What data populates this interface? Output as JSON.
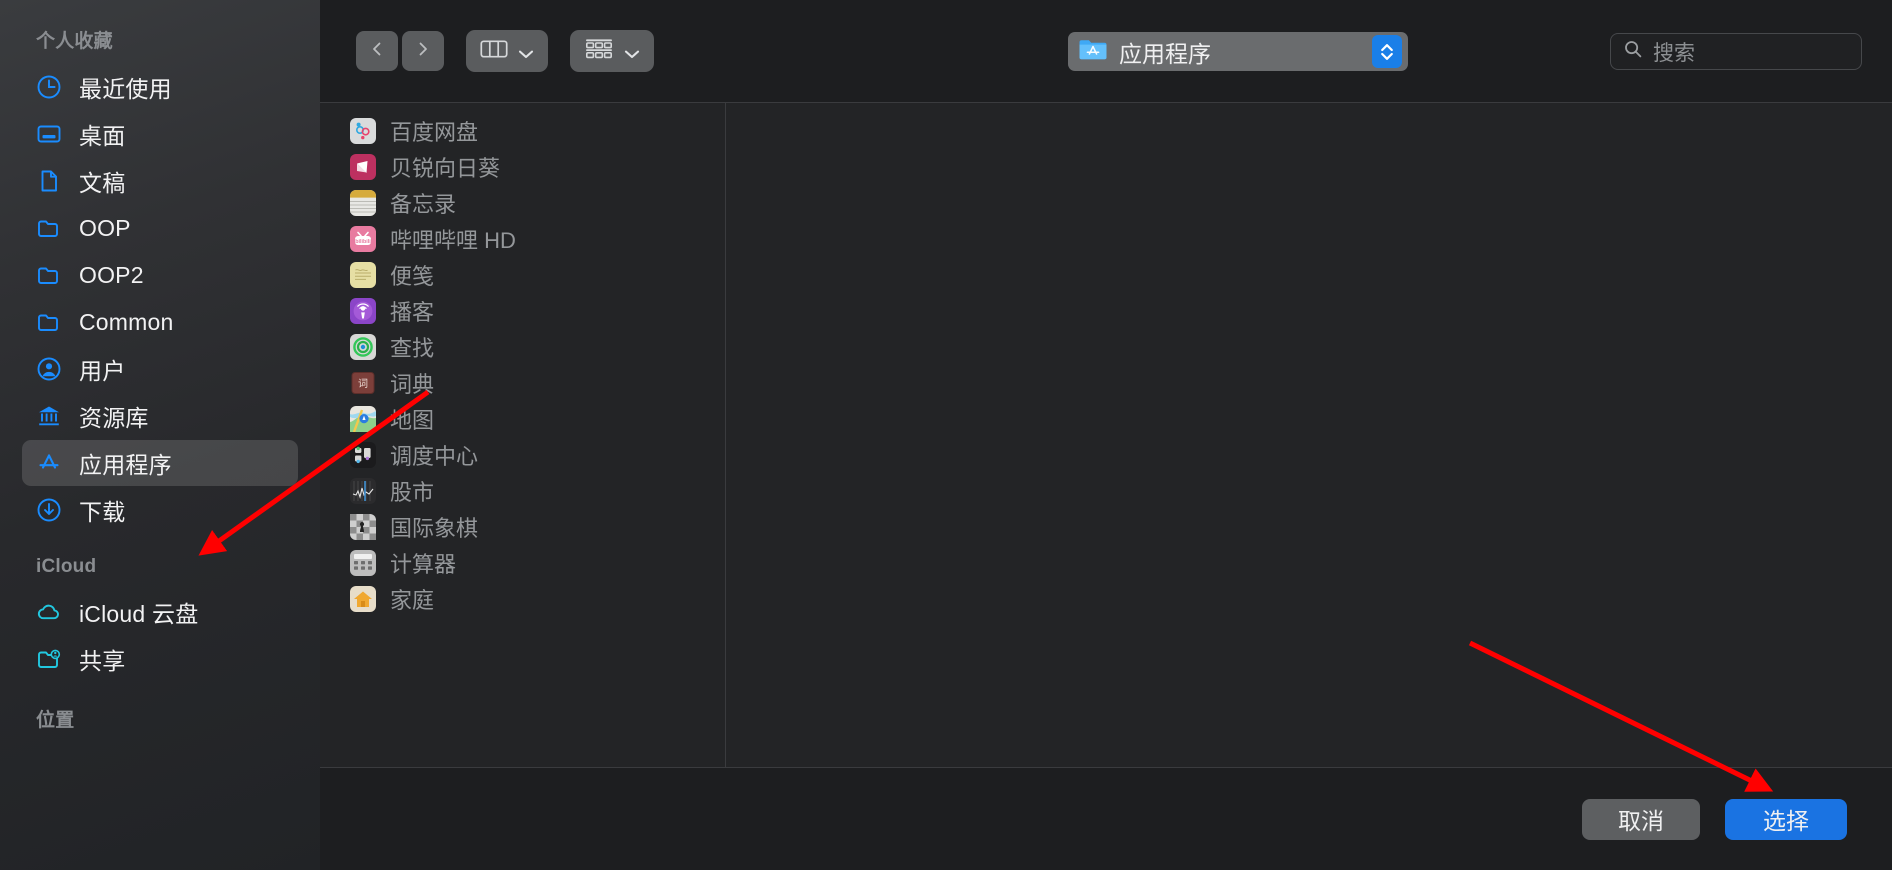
{
  "sidebar": {
    "sections": [
      {
        "title": "个人收藏",
        "items": [
          {
            "label": "最近使用",
            "icon": "clock-icon",
            "selected": false
          },
          {
            "label": "桌面",
            "icon": "desktop-icon",
            "selected": false
          },
          {
            "label": "文稿",
            "icon": "document-icon",
            "selected": false
          },
          {
            "label": "OOP",
            "icon": "folder-icon",
            "selected": false
          },
          {
            "label": "OOP2",
            "icon": "folder-icon",
            "selected": false
          },
          {
            "label": "Common",
            "icon": "folder-icon",
            "selected": false
          },
          {
            "label": "用户",
            "icon": "user-icon",
            "selected": false
          },
          {
            "label": "资源库",
            "icon": "library-icon",
            "selected": false
          },
          {
            "label": "应用程序",
            "icon": "appstore-icon",
            "selected": true
          },
          {
            "label": "下载",
            "icon": "download-icon",
            "selected": false
          }
        ]
      },
      {
        "title": "iCloud",
        "items": [
          {
            "label": "iCloud 云盘",
            "icon": "cloud-icon",
            "selected": false
          },
          {
            "label": "共享",
            "icon": "shared-folder-icon",
            "selected": false
          }
        ]
      },
      {
        "title": "位置",
        "items": []
      }
    ]
  },
  "toolbar": {
    "back_icon": "chevron-left-icon",
    "forward_icon": "chevron-right-icon",
    "view_icon": "column-view-icon",
    "view_chevron_icon": "chevron-down-icon",
    "group_icon": "group-by-icon",
    "group_chevron_icon": "chevron-down-icon",
    "path": {
      "label": "应用程序",
      "folder_icon": "appstore-folder-icon",
      "stepper_icon": "up-down-stepper-icon"
    },
    "search": {
      "placeholder": "搜索",
      "icon": "search-icon",
      "value": ""
    }
  },
  "file_list": {
    "items": [
      {
        "name": "百度网盘",
        "icon": "baidu-netdisk-icon"
      },
      {
        "name": "贝锐向日葵",
        "icon": "sunlogin-icon"
      },
      {
        "name": "备忘录",
        "icon": "notes-icon"
      },
      {
        "name": "哔哩哔哩 HD",
        "icon": "bilibili-icon"
      },
      {
        "name": "便笺",
        "icon": "stickies-icon"
      },
      {
        "name": "播客",
        "icon": "podcasts-icon"
      },
      {
        "name": "查找",
        "icon": "findmy-icon"
      },
      {
        "name": "词典",
        "icon": "dictionary-icon"
      },
      {
        "name": "地图",
        "icon": "maps-icon"
      },
      {
        "name": "调度中心",
        "icon": "mission-control-icon"
      },
      {
        "name": "股市",
        "icon": "stocks-icon"
      },
      {
        "name": "国际象棋",
        "icon": "chess-icon"
      },
      {
        "name": "计算器",
        "icon": "calculator-icon"
      },
      {
        "name": "家庭",
        "icon": "home-icon"
      }
    ]
  },
  "footer": {
    "cancel_label": "取消",
    "choose_label": "选择"
  },
  "colors": {
    "accent": "#1a73e2",
    "sidebar_icon": "#1a8cff",
    "icloud_icon": "#22c8e0",
    "annotation": "#ff0000"
  }
}
